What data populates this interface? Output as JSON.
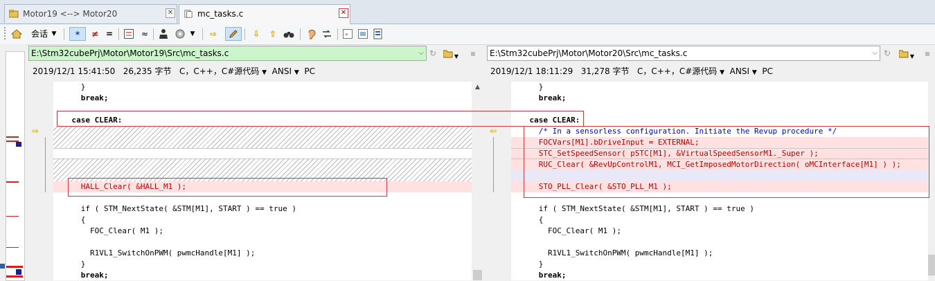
{
  "tabs": [
    {
      "label": "Motor19 <--> Motor20"
    },
    {
      "label": "mc_tasks.c"
    }
  ],
  "toolbar": {
    "session_label": "会话",
    "icons": [
      "home-icon",
      "star-icon",
      "not-equal-icon",
      "equal-icon",
      "diff-icon",
      "approx-icon",
      "person-icon",
      "rules-icon",
      "arrow-right-icon",
      "pencil-icon",
      "arrow-down-icon",
      "arrow-up-icon",
      "binoculars-icon",
      "ear-icon",
      "swap-icon",
      "expand-icon",
      "open-folder-icon",
      "report-icon"
    ]
  },
  "left": {
    "path": "E:\\Stm32cubePrj\\Motor\\Motor19\\Src\\mc_tasks.c",
    "date": "2019/12/1 15:41:50",
    "size": "26,235 字节",
    "format": "C，C++，C#源代码",
    "encoding": "ANSI",
    "lineend": "PC"
  },
  "right": {
    "path": "E:\\Stm32cubePrj\\Motor\\Motor20\\Src\\mc_tasks.c",
    "date": "2019/12/1 18:11:29",
    "size": "31,278 字节",
    "format": "C，C++，C#源代码",
    "encoding": "ANSI",
    "lineend": "PC"
  },
  "colors": {
    "path_left_bg": "#ccf5cc",
    "path_right_bg": "#ffffff",
    "diff_line_bg": "#ffe1e1",
    "diff_blank_bg": "#e8e8f8",
    "diff_text": "#c00000",
    "annotation_box": "#d0393f"
  },
  "code": {
    "left": [
      "      }",
      "      break;",
      "",
      "    case CLEAR:",
      "",
      "",
      "",
      "",
      "",
      "      HALL_Clear( &HALL_M1 );",
      "",
      "      if ( STM_NextState( &STM[M1], START ) == true )",
      "      {",
      "        FOC_Clear( M1 );",
      "",
      "        R1VL1_SwitchOnPWM( pwmcHandle[M1] );",
      "      }",
      "      break;"
    ],
    "right": [
      "      }",
      "      break;",
      "",
      "    case CLEAR:",
      "      /* In a sensorless configuration. Initiate the Revup procedure */",
      "      FOCVars[M1].bDriveInput = EXTERNAL;",
      "      STC_SetSpeedSensor( pSTC[M1], &VirtualSpeedSensorM1._Super );",
      "      RUC_Clear( &RevUpControlM1, MCI_GetImposedMotorDirection( oMCInterface[M1] ) );",
      "",
      "      STO_PLL_Clear( &STO_PLL_M1 );",
      "",
      "      if ( STM_NextState( &STM[M1], START ) == true )",
      "      {",
      "        FOC_Clear( M1 );",
      "",
      "        R1VL1_SwitchOnPWM( pwmcHandle[M1] );",
      "      }",
      "      break;"
    ]
  }
}
